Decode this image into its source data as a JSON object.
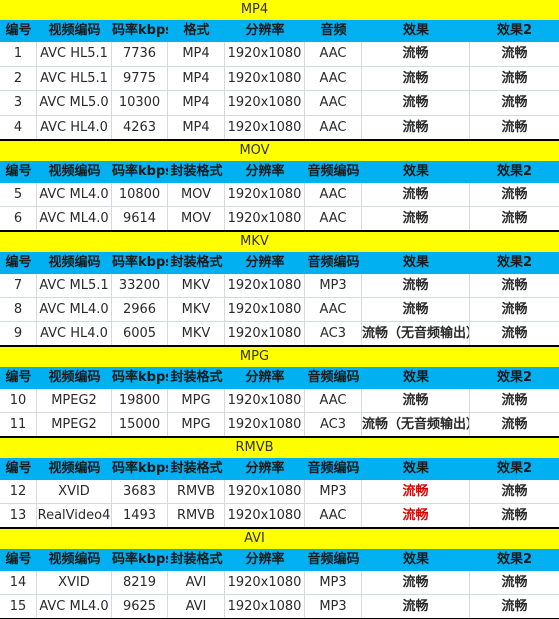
{
  "colors": {
    "title_bg": "#ffff00",
    "header_bg": "#00b0f0",
    "highlight_text": "#e00000"
  },
  "sections": [
    {
      "title": "MP4",
      "headers": [
        "编号",
        "视频编码",
        "码率kbps",
        "格式",
        "分辨率",
        "音频",
        "效果",
        "效果2"
      ],
      "rows": [
        [
          "1",
          "AVC HL5.1",
          "7736",
          "MP4",
          "1920x1080",
          "AAC",
          "流畅",
          "流畅"
        ],
        [
          "2",
          "AVC HL5.1",
          "9775",
          "MP4",
          "1920x1080",
          "AAC",
          "流畅",
          "流畅"
        ],
        [
          "3",
          "AVC ML5.0",
          "10300",
          "MP4",
          "1920x1080",
          "AAC",
          "流畅",
          "流畅"
        ],
        [
          "4",
          "AVC HL4.0",
          "4263",
          "MP4",
          "1920x1080",
          "AAC",
          "流畅",
          "流畅"
        ]
      ]
    },
    {
      "title": "MOV",
      "headers": [
        "编号",
        "视频编码",
        "码率kbps",
        "封装格式",
        "分辨率",
        "音频编码",
        "效果",
        "效果2"
      ],
      "rows": [
        [
          "5",
          "AVC ML4.0",
          "10800",
          "MOV",
          "1920x1080",
          "AAC",
          "流畅",
          "流畅"
        ],
        [
          "6",
          "AVC ML4.0",
          "9614",
          "MOV",
          "1920x1080",
          "AAC",
          "流畅",
          "流畅"
        ]
      ]
    },
    {
      "title": "MKV",
      "headers": [
        "编号",
        "视频编码",
        "码率kbps",
        "封装格式",
        "分辨率",
        "音频编码",
        "效果",
        "效果2"
      ],
      "rows": [
        [
          "7",
          "AVC ML5.1",
          "33200",
          "MKV",
          "1920x1080",
          "MP3",
          "流畅",
          "流畅"
        ],
        [
          "8",
          "AVC ML4.0",
          "2966",
          "MKV",
          "1920x1080",
          "AAC",
          "流畅",
          "流畅"
        ],
        [
          "9",
          "AVC HL4.0",
          "6005",
          "MKV",
          "1920x1080",
          "AC3",
          "流畅（无音频输出）",
          "流畅"
        ]
      ]
    },
    {
      "title": "MPG",
      "headers": [
        "编号",
        "视频编码",
        "码率kbps",
        "封装格式",
        "分辨率",
        "音频编码",
        "效果",
        "效果2"
      ],
      "rows": [
        [
          "10",
          "MPEG2",
          "19800",
          "MPG",
          "1920x1080",
          "AAC",
          "流畅",
          "流畅"
        ],
        [
          "11",
          "MPEG2",
          "15000",
          "MPG",
          "1920x1080",
          "AC3",
          "流畅（无音频输出）",
          "流畅"
        ]
      ]
    },
    {
      "title": "RMVB",
      "headers": [
        "编号",
        "视频编码",
        "码率kbps",
        "封装格式",
        "分辨率",
        "音频编码",
        "效果",
        "效果2"
      ],
      "rows": [
        [
          "12",
          "XVID",
          "3683",
          "RMVB",
          "1920x1080",
          "MP3",
          "流畅",
          "流畅"
        ],
        [
          "13",
          "RealVideo4",
          "1493",
          "RMVB",
          "1920x1080",
          "AAC",
          "流畅",
          "流畅"
        ]
      ],
      "effect_red": true
    },
    {
      "title": "AVI",
      "headers": [
        "编号",
        "视频编码",
        "码率kbps",
        "封装格式",
        "分辨率",
        "音频编码",
        "效果",
        "效果2"
      ],
      "rows": [
        [
          "14",
          "XVID",
          "8219",
          "AVI",
          "1920x1080",
          "MP3",
          "流畅",
          "流畅"
        ],
        [
          "15",
          "AVC ML4.0",
          "9625",
          "AVI",
          "1920x1080",
          "MP3",
          "流畅",
          "流畅"
        ]
      ]
    }
  ]
}
